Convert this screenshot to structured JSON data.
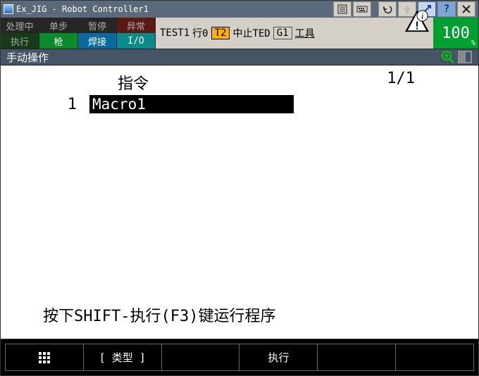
{
  "title": "Ex_JIG - Robot Controller1",
  "titlebar_icons": [
    "list-icon",
    "keyboard-icon",
    "undo-icon",
    "up-icon",
    "diag-icon",
    "help-icon",
    "close-icon"
  ],
  "status": {
    "row1": [
      "处理中",
      "单步",
      "暂停",
      "异常"
    ],
    "row2": [
      "执行",
      "枪",
      "焊接",
      "I/O"
    ]
  },
  "info": {
    "prog": "TEST1",
    "line": "行0",
    "mode": "T2",
    "state": "中止TED",
    "g": "G1",
    "tool": "工具"
  },
  "percent": "100",
  "percent_sub": "%",
  "subtitle": "手动操作",
  "page_indicator": "1/1",
  "col_header": "指令",
  "rows": [
    {
      "n": "1",
      "text": "Macro1"
    }
  ],
  "hint": "按下SHIFT-执行(F3)键运行程序",
  "fkeys": {
    "f1_icon": "grid-icon",
    "f2": "[ 类型 ]",
    "f3": "",
    "f4": "执行",
    "f5": "",
    "f6": ""
  }
}
